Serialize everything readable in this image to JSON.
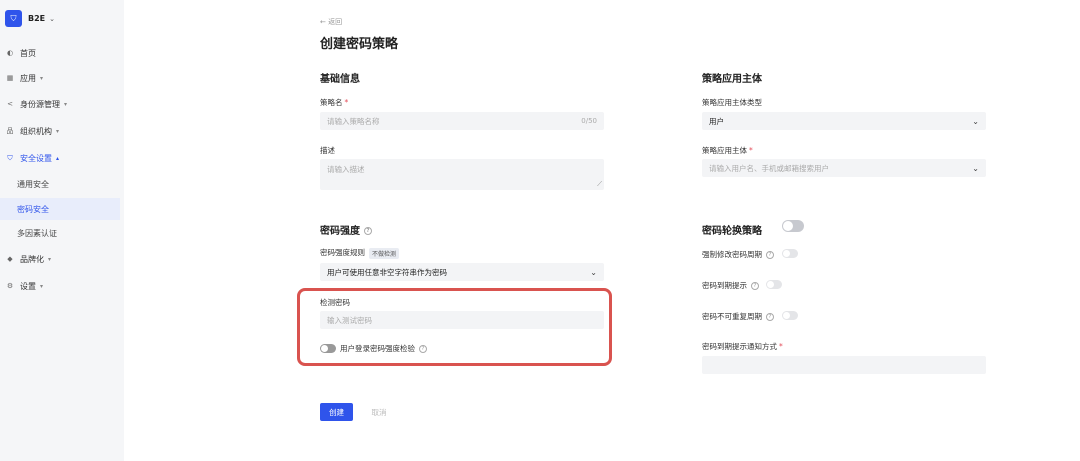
{
  "app": {
    "brand": "B2E"
  },
  "sidebar": {
    "items": [
      {
        "label": "首页",
        "icon": "home-icon"
      },
      {
        "label": "应用",
        "icon": "grid-icon"
      },
      {
        "label": "身份源管理",
        "icon": "share-icon"
      },
      {
        "label": "组织机构",
        "icon": "org-icon"
      },
      {
        "label": "安全设置",
        "icon": "shield-icon"
      },
      {
        "label": "品牌化",
        "icon": "brand-icon"
      },
      {
        "label": "设置",
        "icon": "gear-icon"
      }
    ],
    "sub_items": [
      {
        "label": "通用安全"
      },
      {
        "label": "密码安全"
      },
      {
        "label": "多因素认证"
      }
    ]
  },
  "header": {
    "back": "返回",
    "title": "创建密码策略"
  },
  "basic": {
    "title": "基础信息",
    "name_label": "策略名",
    "name_placeholder": "请输入策略名称",
    "name_counter": "0/50",
    "desc_label": "描述",
    "desc_placeholder": "请输入描述"
  },
  "subject": {
    "title": "策略应用主体",
    "type_label": "策略应用主体类型",
    "type_value": "用户",
    "subject_label": "策略应用主体",
    "subject_placeholder": "请输入用户名、手机或邮箱搜索用户"
  },
  "strength": {
    "title": "密码强度",
    "rule_label": "密码强度规则",
    "rule_tag": "不做检测",
    "rule_value": "用户可使用任意非空字符串作为密码",
    "test_label": "检测密码",
    "test_placeholder": "输入测试密码",
    "login_check_label": "用户登录密码强度检验"
  },
  "rotation": {
    "title": "密码轮换策略",
    "force_label": "强制修改密码周期",
    "expire_label": "密码到期提示",
    "no_repeat_label": "密码不可重复周期",
    "notify_label": "密码到期提示通知方式"
  },
  "actions": {
    "create": "创建",
    "cancel": "取消"
  },
  "colors": {
    "primary": "#2f54eb",
    "highlight": "#d9534f"
  }
}
